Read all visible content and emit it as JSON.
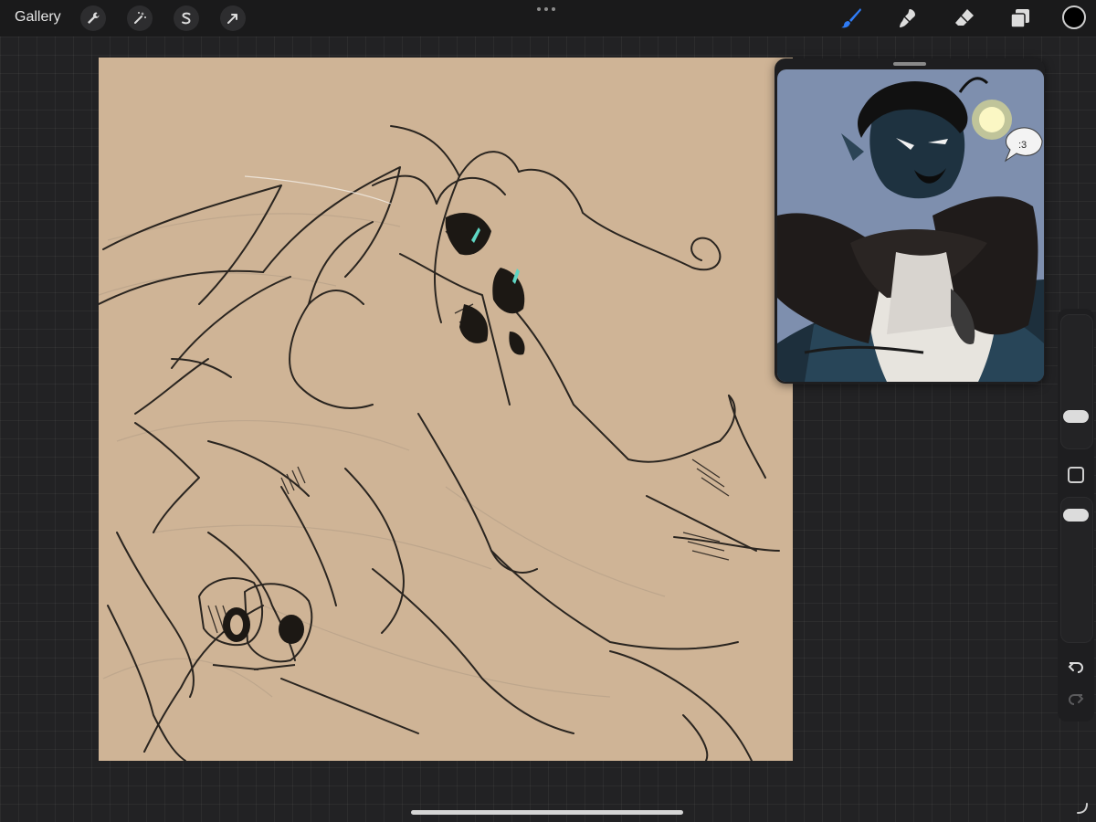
{
  "app": {
    "gallery_label": "Gallery"
  },
  "toolbar_left": [
    {
      "name": "actions-wrench-icon"
    },
    {
      "name": "adjustments-magic-wand-icon"
    },
    {
      "name": "selection-s-icon"
    },
    {
      "name": "transform-arrow-icon"
    }
  ],
  "toolbar_right": [
    {
      "name": "brush-icon",
      "active": true
    },
    {
      "name": "smudge-icon"
    },
    {
      "name": "eraser-icon"
    },
    {
      "name": "layers-icon"
    }
  ],
  "colors": {
    "active_tool": "#2f7cf6",
    "canvas_background": "#cfb496",
    "selected_color": "#000000",
    "ui_background": "#222224",
    "toolbar_background": "#1a1a1b"
  },
  "reference": {
    "speech_bubble_text": ":3"
  }
}
